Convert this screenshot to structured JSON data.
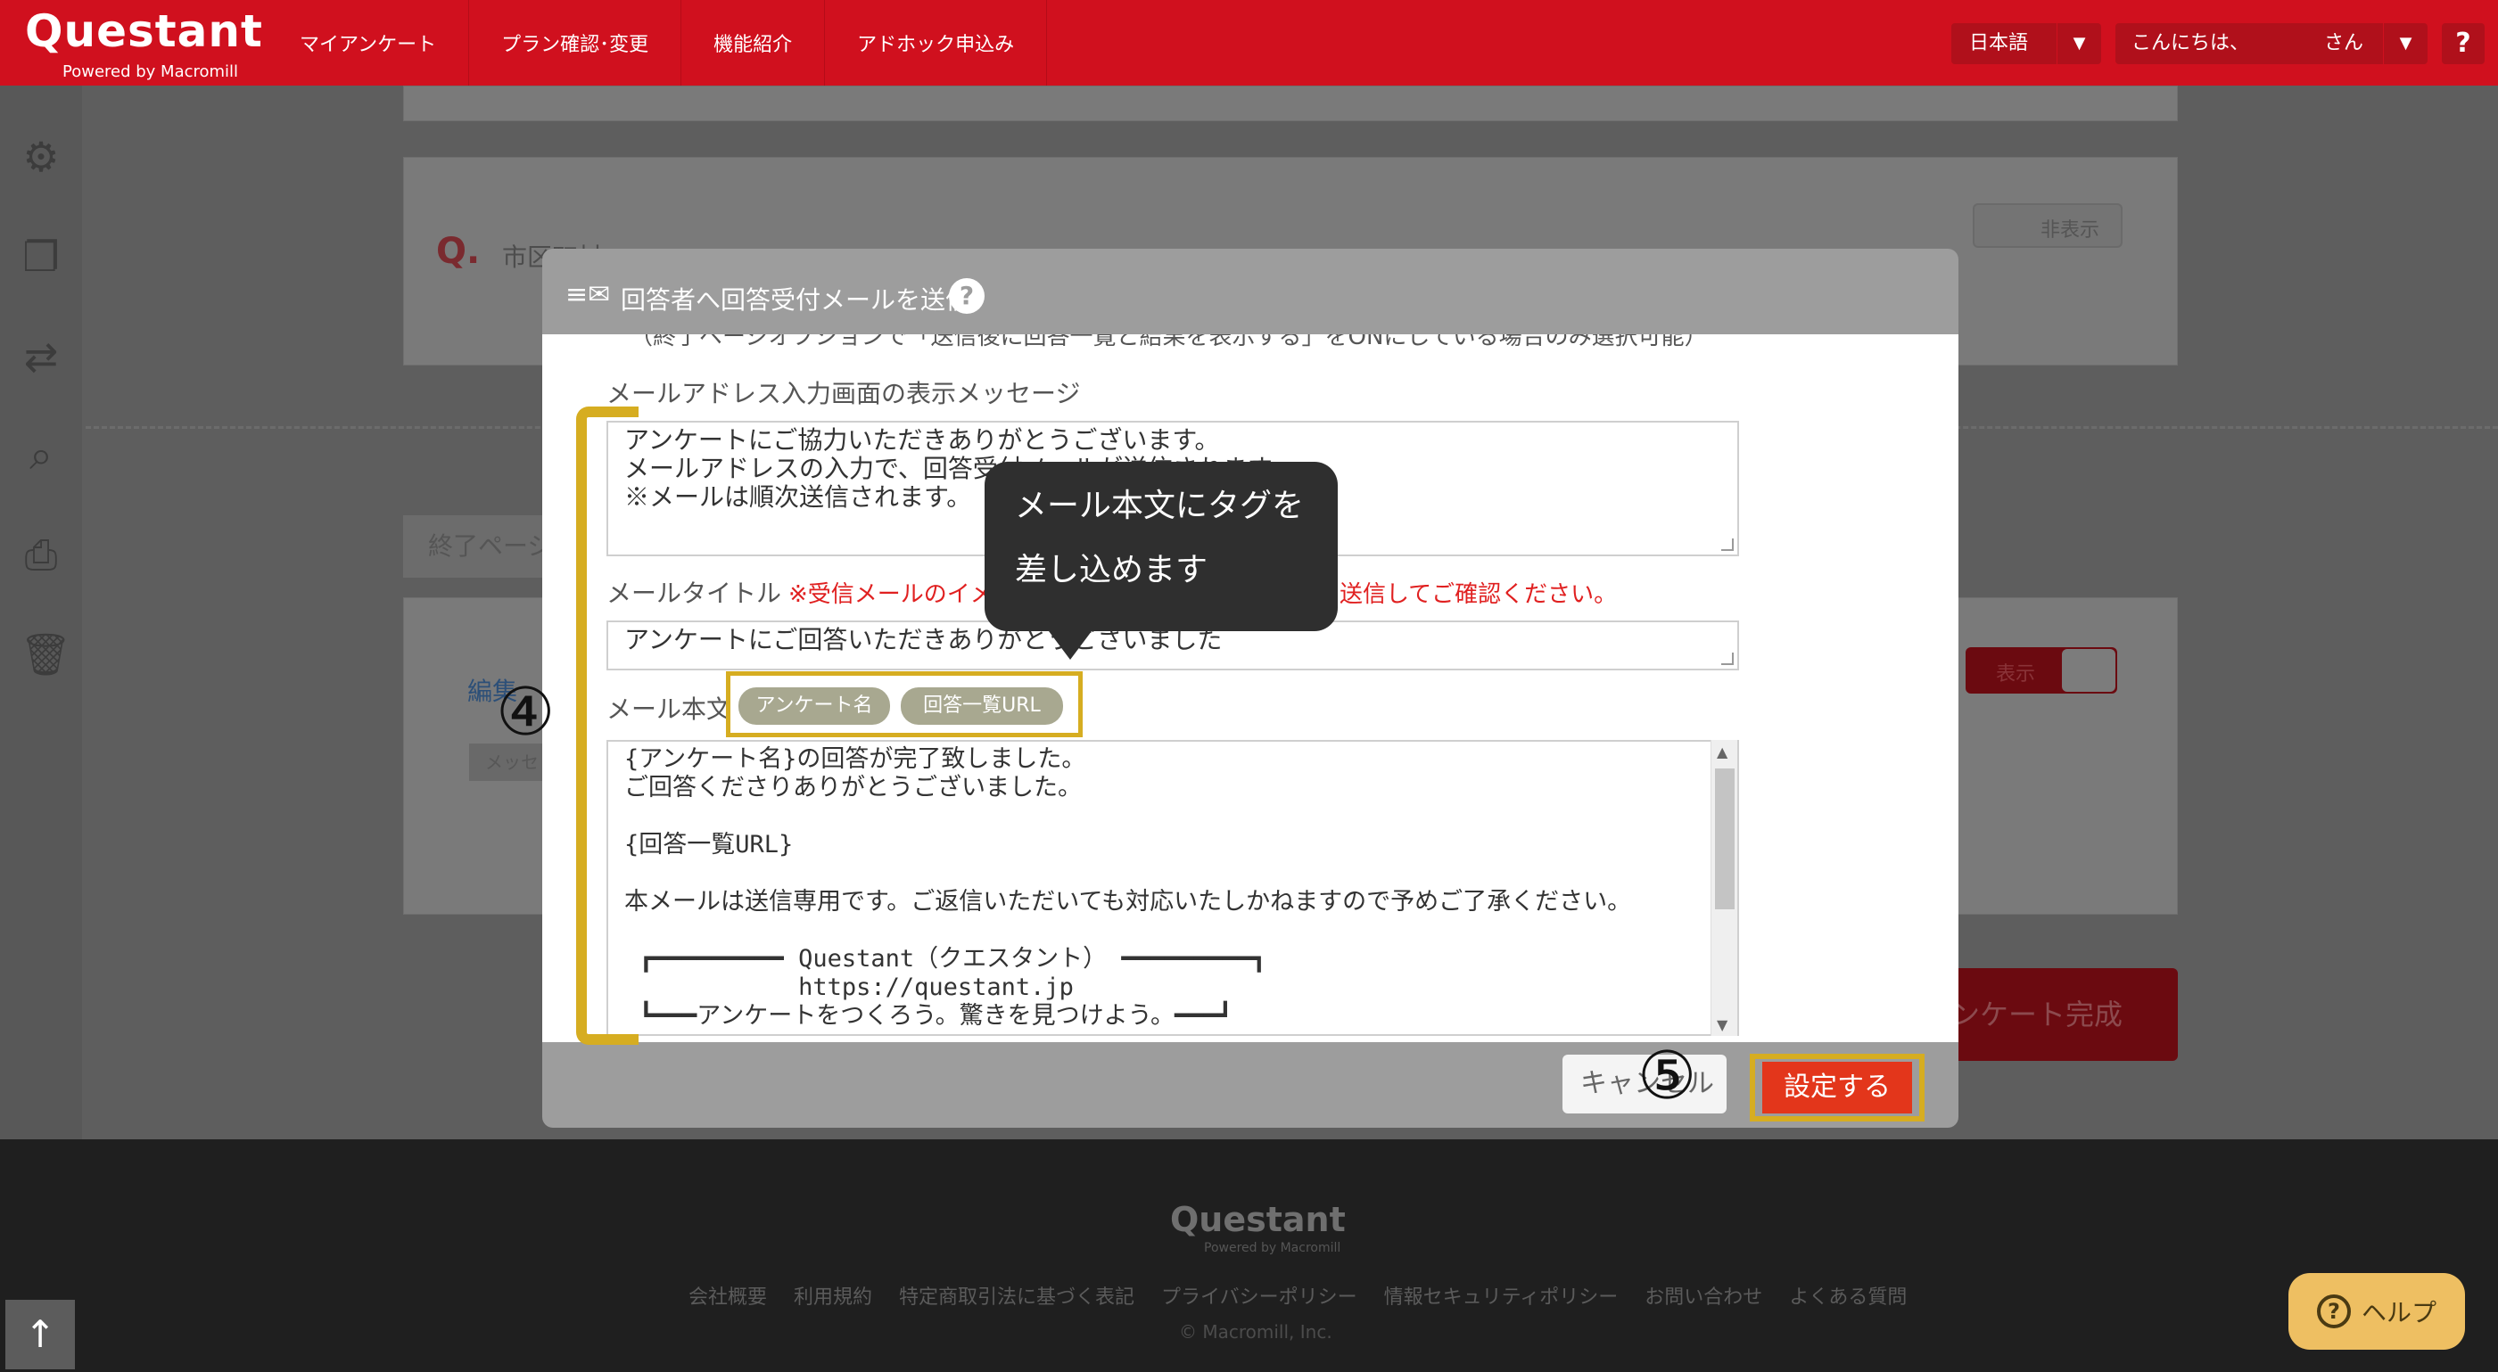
{
  "topbar": {
    "logo": "Questant",
    "logo_sub": "Powered by Macromill",
    "nav": [
      "マイアンケート",
      "プラン確認･変更",
      "機能紹介",
      "アドホック申込み"
    ],
    "language": "日本語",
    "greeting": "こんにちは、",
    "greeting_suffix": "さん",
    "help": "?"
  },
  "background": {
    "q_mark": "Q.",
    "q_label": "市区町村",
    "hidden_toggle": "非表示",
    "end_page_tab": "終了ページ",
    "edit_link": "編集",
    "message_chip": "メッセ",
    "shown_toggle": "表示",
    "complete_button": "アンケート完成"
  },
  "modal": {
    "title": "回答者へ回答受付メールを送信",
    "help": "?",
    "cut_text": "（終了ページオプションで「送信後に回答一覧と結果を表示する」をONにしている場合のみ選択可能）",
    "email_message_label": "メールアドレス入力画面の表示メッセージ",
    "email_message_value": "アンケートにご協力いただきありがとうございます。\nメールアドレスの入力で、回答受付メールが送信されます。\n※メールは順次送信されます。",
    "mail_title_label": "メールタイトル",
    "mail_title_note": "※受信メールのイメージについては、実際にメールを送信してご確認ください。",
    "mail_title_value": "アンケートにご回答いただきありがとうございました",
    "mail_body_label": "メール本文",
    "tags": [
      "アンケート名",
      "回答一覧URL"
    ],
    "mail_body_value": "{アンケート名}の回答が完了致しました。\nご回答くださりありがとうございました。\n\n{回答一覧URL}\n\n本メールは送信専用です。ご返信いただいても対応いたしかねますので予めご了承ください。\n\n ┏━━━━━━━━━ Questant（クエスタント） ━━━━━━━━━┓\n            https://questant.jp\n ┗━━━アンケートをつくろう。驚きを見つけよう。━━━┛",
    "cancel": "キャンセル",
    "submit": "設定する"
  },
  "annotations": {
    "step4": "④",
    "step5": "⑤",
    "tooltip_line1": "メール本文にタグを",
    "tooltip_line2": "差し込めます",
    "highlight_color": "#d6ad21"
  },
  "footer": {
    "logo": "Questant",
    "logo_sub": "Powered by Macromill",
    "links": [
      "会社概要",
      "利用規約",
      "特定商取引法に基づく表記",
      "プライバシーポリシー",
      "情報セキュリティポリシー",
      "お問い合わせ",
      "よくある質問"
    ],
    "copyright": "© Macromill, Inc.",
    "to_top": "↑",
    "help_label": "ヘルプ",
    "help_icon": "?"
  },
  "colors": {
    "brand_red": "#d0101e",
    "submit_red": "#e3361b",
    "overlay": "#5e5e5e"
  }
}
